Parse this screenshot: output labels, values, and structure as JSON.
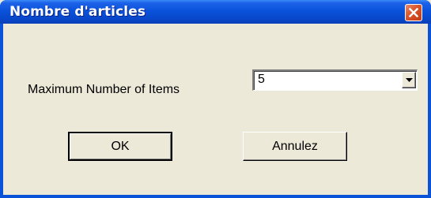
{
  "window": {
    "title": "Nombre d'articles",
    "close_icon": "close-icon",
    "accent_color": "#0a52dc",
    "close_color": "#d9542a"
  },
  "form": {
    "label": "Maximum Number of Items",
    "select_value": "5",
    "dropdown_icon": "chevron-down-icon"
  },
  "buttons": {
    "ok_label": "OK",
    "cancel_label": "Annulez"
  }
}
